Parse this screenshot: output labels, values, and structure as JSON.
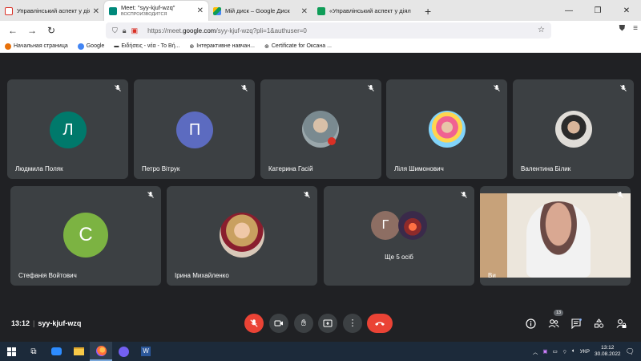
{
  "browser": {
    "tabs": [
      {
        "title": "Управлінський аспект у діяльн",
        "sub": "",
        "color": "#d93025",
        "active": false
      },
      {
        "title": "Meet: \"syy-kjuf-wzq\"",
        "sub": "ВОСПРОИЗВОДИТСЯ",
        "color": "#00897b",
        "active": true
      },
      {
        "title": "Мій диск – Google Диск",
        "sub": "",
        "color": "#fbbc04",
        "active": false
      },
      {
        "title": "«Управлінський аспект у діял",
        "sub": "",
        "color": "#0f9d58",
        "active": false
      }
    ],
    "url_prefix": "https://meet.",
    "url_host": "google.com",
    "url_path": "/syy-kjuf-wzq?pli=1&authuser=0",
    "bookmarks": [
      {
        "label": "Начальная страница",
        "color": "#e8710a"
      },
      {
        "label": "Google",
        "color": "#4285f4"
      },
      {
        "label": "Ειδήσεις - νέα - Το Βή...",
        "color": "#555555"
      },
      {
        "label": "Інтерактивне навчан...",
        "color": "#444444"
      },
      {
        "label": "Certificate for Оксана ...",
        "color": "#444444"
      }
    ]
  },
  "participants": [
    {
      "name": "Людмила Поляк",
      "initial": "Л",
      "avatar_color": "#00796b",
      "type": "initial"
    },
    {
      "name": "Петро Вітрук",
      "initial": "П",
      "avatar_color": "#5c6bc0",
      "type": "initial"
    },
    {
      "name": "Катерина Гасій",
      "initial": "",
      "avatar_color": "#8d9ba0",
      "type": "photo"
    },
    {
      "name": "Ліля Шимонович",
      "initial": "",
      "avatar_color": "#e57373",
      "type": "photo"
    },
    {
      "name": "Валентина Білик",
      "initial": "",
      "avatar_color": "#6d5d55",
      "type": "photo"
    },
    {
      "name": "Стефанія Войтович",
      "initial": "С",
      "avatar_color": "#7cb342",
      "type": "initial"
    },
    {
      "name": "Ірина Михайленко",
      "initial": "",
      "avatar_color": "#b07a55",
      "type": "photo"
    },
    {
      "name": "",
      "initial": "Г",
      "avatar_color": "#8d6e63",
      "type": "group",
      "more_label": "Ще 5 осіб"
    },
    {
      "name": "Ви",
      "initial": "",
      "avatar_color": "#c9a882",
      "type": "video"
    }
  ],
  "meeting": {
    "time": "13:12",
    "code": "syy-kjuf-wzq",
    "people_count": "13"
  },
  "taskbar": {
    "language": "УКР",
    "time": "13:12",
    "date": "30.08.2022"
  }
}
